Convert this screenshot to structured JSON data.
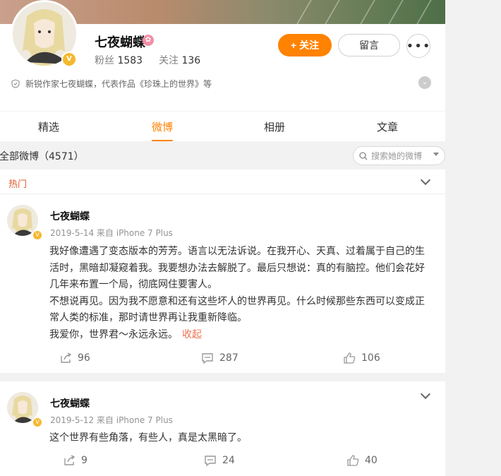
{
  "profile": {
    "nickname": "七夜蝴蝶",
    "followers_label": "粉丝",
    "followers_count": "1583",
    "following_label": "关注",
    "following_count": "136",
    "follow_button": "关注",
    "message_button": "留言",
    "more_button": "•••",
    "bio": "新锐作家七夜蝴蝶，代表作品《珍珠上的世界》等"
  },
  "tabs": [
    {
      "label": "精选",
      "active": false
    },
    {
      "label": "微博",
      "active": true
    },
    {
      "label": "相册",
      "active": false
    },
    {
      "label": "文章",
      "active": false
    }
  ],
  "filter": {
    "label": "全部微博（4571）",
    "search_placeholder": "搜索她的微博"
  },
  "posts": [
    {
      "section_label": "热门",
      "author": "七夜蝴蝶",
      "meta": "2019-5-14  来自 iPhone 7 Plus",
      "paragraphs": [
        "我好像遭遇了变态版本的芳芳。语言以无法诉说。在我开心、天真、过着属于自己的生活时，黑暗却凝窥着我。我要想办法去解脱了。最后只想说：真的有脑控。他们会花好几年来布置一个局，彻底网住要害人。",
        "不想说再见。因为我不愿意和还有这些坏人的世界再见。什么时候那些东西可以变成正常人类的标准，那时请世界再让我重新降临。",
        "我爱你，世界君～永远永远。"
      ],
      "collapse_label": "收起",
      "reposts": "96",
      "comments": "287",
      "likes": "106"
    },
    {
      "author": "七夜蝴蝶",
      "meta": "2019-5-12  来自 iPhone 7 Plus",
      "paragraphs": [
        "这个世界有些角落，有些人，真是太黑暗了。"
      ],
      "reposts": "9",
      "comments": "24",
      "likes": "40"
    }
  ],
  "colors": {
    "accent": "#ff8200",
    "hot": "#e05b2e",
    "collapse": "#eb7350",
    "verified": "#f5b82e"
  },
  "icons": [
    "shield-icon",
    "chevron-down-icon",
    "search-icon",
    "repost-icon",
    "comment-icon",
    "like-icon",
    "verified-icon",
    "plus-icon"
  ]
}
